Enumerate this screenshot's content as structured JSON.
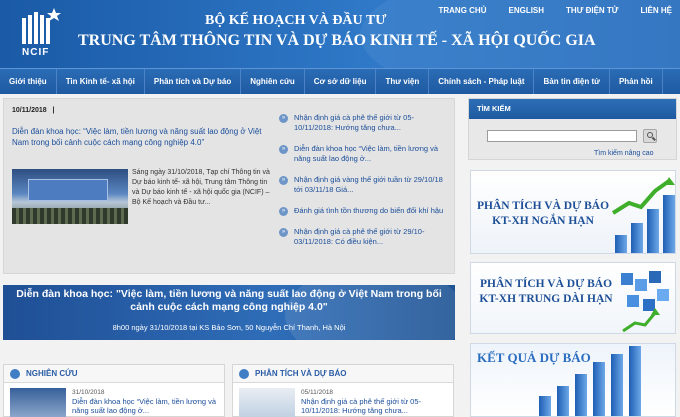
{
  "header": {
    "logo_text": "NCIF",
    "ministry": "BỘ KẾ HOẠCH VÀ ĐẦU TƯ",
    "center_name": "TRUNG TÂM THÔNG TIN VÀ DỰ BÁO KINH TẾ - XÃ HỘI QUỐC GIA",
    "top_links": [
      "TRANG CHỦ",
      "ENGLISH",
      "THƯ ĐIỆN TỬ",
      "LIÊN HỆ"
    ]
  },
  "nav": [
    "Giới thiệu",
    "Tin Kinh tế- xã hội",
    "Phân tích và Dự báo",
    "Nghiên cứu",
    "Cơ sở dữ liệu",
    "Thư viện",
    "Chính sách - Pháp luật",
    "Bản tin điện tử",
    "Phản hồi"
  ],
  "featured": {
    "date": "10/11/2018",
    "separator": "|",
    "title": "Diễn đàn khoa học: “Việc làm, tiền lương và năng suất lao động ở Việt Nam  trong bối cảnh cuộc cách mạng công nghiệp 4.0”",
    "summary": "Sáng ngày 31/10/2018, Tạp chí Thông tin và Dự báo kinh tế- xã hội, Trung tâm Thông tin và Dự báo kinh tế - xã hội quốc gia (NCIF) – Bộ Kế hoạch và Đầu tư..."
  },
  "news": [
    "Nhận định giá cà phê thế giới từ 05-10/11/2018: Hướng tăng chưa...",
    "Diễn đàn khoa học “Việc làm, tiền lương và năng suất lao động ở...",
    "Nhận định giá vàng thế giới tuần từ 29/10/18 tới 03/11/18 Giá...",
    "Đánh giá tình tồn thương do biến đổi khí hậu",
    "Nhận định giá cà phê thế giới từ 29/10-03/11/2018: Có điều kiện..."
  ],
  "banner": {
    "title": "Diễn đàn khoa học: \"Việc làm, tiền lương và năng suất lao động ở Việt Nam trong bối cảnh cuộc cách mạng công nghiệp 4.0\"",
    "subtitle": "8h00 ngày 31/10/2018 tại KS Bảo Sơn, 50 Nguyễn Chí Thanh, Hà Nội"
  },
  "sections": [
    {
      "heading": "NGHIÊN CỨU",
      "date": "31/10/2018",
      "text": "Diễn đàn khoa học “Việc làm, tiền lương và năng suất lao động ở..."
    },
    {
      "heading": "PHÂN TÍCH VÀ DỰ BÁO",
      "date": "05/11/2018",
      "text": "Nhận định giá cà phê thế giới từ 05-10/11/2018: Hướng tăng chưa..."
    }
  ],
  "search": {
    "heading": "TÌM KIẾM",
    "placeholder": "",
    "advanced": "Tìm kiếm nâng cao"
  },
  "promos": {
    "short_term": "PHÂN TÍCH VÀ DỰ BÁO KT-XH NGẮN HẠN",
    "mid_long_term": "PHÂN TÍCH VÀ DỰ BÁO KT-XH TRUNG DÀI HẠN",
    "forecast_results": "KẾT QUẢ DỰ BÁO"
  },
  "colors": {
    "brand_blue": "#1a5aa6",
    "link_blue": "#1a4d99",
    "background": "#f2f2f2"
  }
}
